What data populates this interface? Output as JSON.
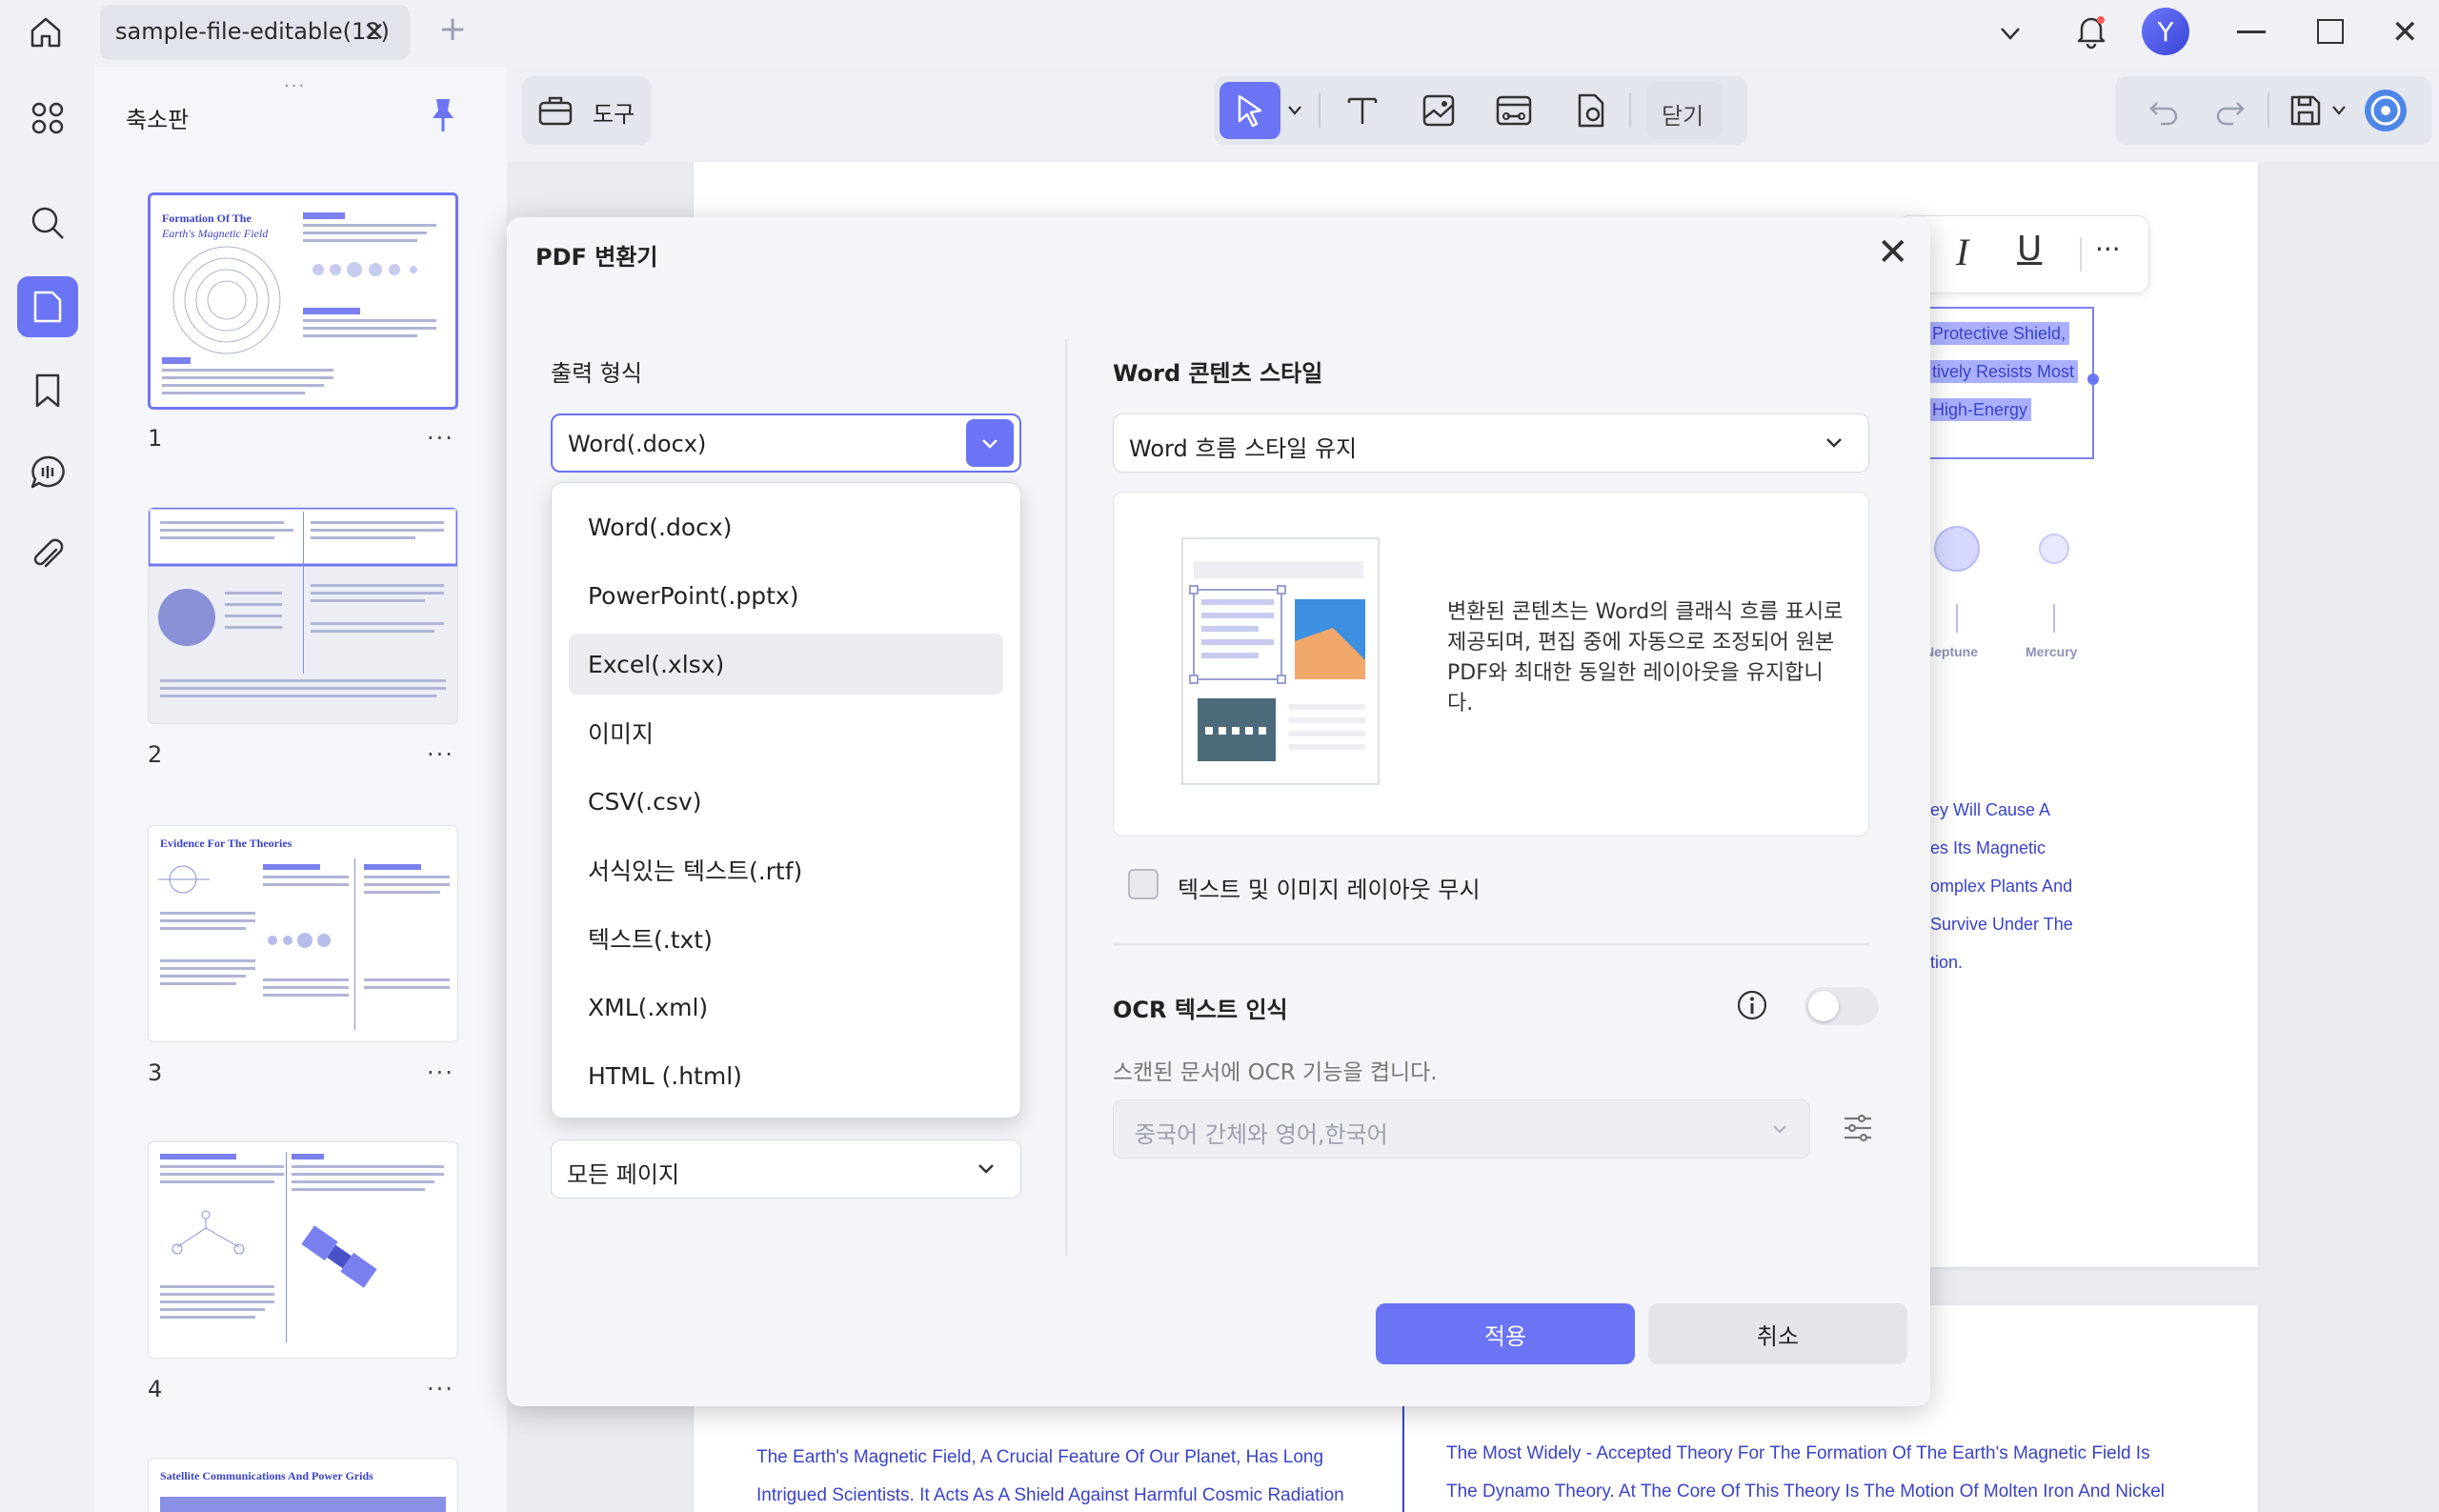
{
  "window": {
    "tab_label": "sample-file-editable(12)",
    "avatar_initial": "Y"
  },
  "sidebar": {
    "panel_title": "축소판",
    "pages": [
      {
        "number": "1"
      },
      {
        "number": "2"
      },
      {
        "number": "3"
      },
      {
        "number": "4"
      }
    ],
    "page_more": "···",
    "thumb_texts": {
      "t1_title_a": "Formation Of The",
      "t1_title_b": "Earth's Magnetic Field",
      "t3_title": "Evidence For The Theories",
      "t5_title": "Satellite Communications And Power Grids"
    }
  },
  "toolbar": {
    "tools_label": "도구",
    "close_label": "닫기"
  },
  "document": {
    "highlight_lines": [
      "Protective Shield,",
      "tively Resists Most",
      "High-Energy"
    ],
    "planet_labels": [
      "Neptune",
      "Mercury"
    ],
    "right_text_lines": [
      "ey Will Cause A",
      "es Its Magnetic",
      "omplex Plants And",
      "Survive Under The",
      "tion."
    ],
    "bottom_left_lines": [
      "The Earth's Magnetic Field, A Crucial Feature Of Our Planet, Has Long",
      "Intrigued Scientists. It Acts As A Shield Against Harmful Cosmic Radiation"
    ],
    "bottom_right_lines": [
      "The Most Widely - Accepted Theory For The Formation Of The Earth's Magnetic Field Is",
      "The Dynamo Theory. At The Core Of This Theory Is The Motion Of Molten Iron And Nickel"
    ]
  },
  "dialog": {
    "title": "PDF 변환기",
    "output_format_label": "출력 형식",
    "output_format_value": "Word(.docx)",
    "format_options": [
      "Word(.docx)",
      "PowerPoint(.pptx)",
      "Excel(.xlsx)",
      "이미지",
      "CSV(.csv)",
      "서식있는 텍스트(.rtf)",
      "텍스트(.txt)",
      "XML(.xml)",
      "HTML (.html)"
    ],
    "hovered_option_index": 2,
    "page_range_value": "모든 페이지",
    "word_style_label": "Word 콘텐츠 스타일",
    "word_style_value": "Word 흐름 스타일 유지",
    "preview_description": "변환된 콘텐츠는 Word의 클래식 흐름 표시로 제공되며, 편집 중에 자동으로 조정되어 원본 PDF와 최대한 동일한 레이아웃을 유지합니다.",
    "ignore_layout_label": "텍스트 및 이미지 레이아웃 무시",
    "ignore_layout_checked": false,
    "ocr_label": "OCR 텍스트 인식",
    "ocr_enabled": false,
    "ocr_description": "스캔된 문서에 OCR 기능을 켭니다.",
    "ocr_language_value": "중국어 간체와 영어,한국어",
    "apply_label": "적용",
    "cancel_label": "취소"
  },
  "colors": {
    "accent": "#6a74f5",
    "doc_text": "#3a43c8"
  }
}
